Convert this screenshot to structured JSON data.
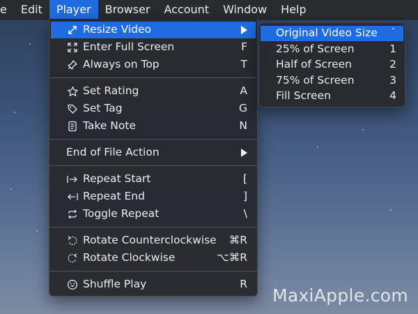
{
  "menubar": {
    "items": [
      "e",
      "Edit",
      "Player",
      "Browser",
      "Account",
      "Window",
      "Help"
    ],
    "active": "Player"
  },
  "player_menu": {
    "resize_video": {
      "label": "Resize Video",
      "icon": "resize-icon"
    },
    "enter_full_screen": {
      "label": "Enter Full Screen",
      "shortcut": "F",
      "icon": "fullscreen-icon"
    },
    "always_on_top": {
      "label": "Always on Top",
      "shortcut": "T",
      "icon": "pin-icon"
    },
    "set_rating": {
      "label": "Set Rating",
      "shortcut": "A",
      "icon": "star-icon"
    },
    "set_tag": {
      "label": "Set Tag",
      "shortcut": "G",
      "icon": "tag-icon"
    },
    "take_note": {
      "label": "Take Note",
      "shortcut": "N",
      "icon": "note-icon"
    },
    "end_of_file_action": {
      "label": "End of File Action"
    },
    "repeat_start": {
      "label": "Repeat Start",
      "shortcut": "[",
      "icon": "repeat-start-icon"
    },
    "repeat_end": {
      "label": "Repeat End",
      "shortcut": "]",
      "icon": "repeat-end-icon"
    },
    "toggle_repeat": {
      "label": "Toggle Repeat",
      "shortcut": "\\",
      "icon": "repeat-icon"
    },
    "rotate_ccw": {
      "label": "Rotate Counterclockwise",
      "shortcut": "⌘R",
      "icon": "rotate-ccw-icon"
    },
    "rotate_cw": {
      "label": "Rotate Clockwise",
      "shortcut": "⌥⌘R",
      "icon": "rotate-cw-icon"
    },
    "shuffle_play": {
      "label": "Shuffle Play",
      "shortcut": "R",
      "icon": "smiley-icon"
    }
  },
  "resize_submenu": {
    "items": [
      {
        "label": "Original Video Size",
        "shortcut": "`"
      },
      {
        "label": "25% of Screen",
        "shortcut": "1"
      },
      {
        "label": "Half of Screen",
        "shortcut": "2"
      },
      {
        "label": "75% of Screen",
        "shortcut": "3"
      },
      {
        "label": "Fill Screen",
        "shortcut": "4"
      }
    ]
  },
  "watermark": "MaxiApple.com",
  "colors": {
    "highlight": "#1f6ce0",
    "menu_bg": "#28292e",
    "menubar_bg": "#2a2b2f"
  }
}
